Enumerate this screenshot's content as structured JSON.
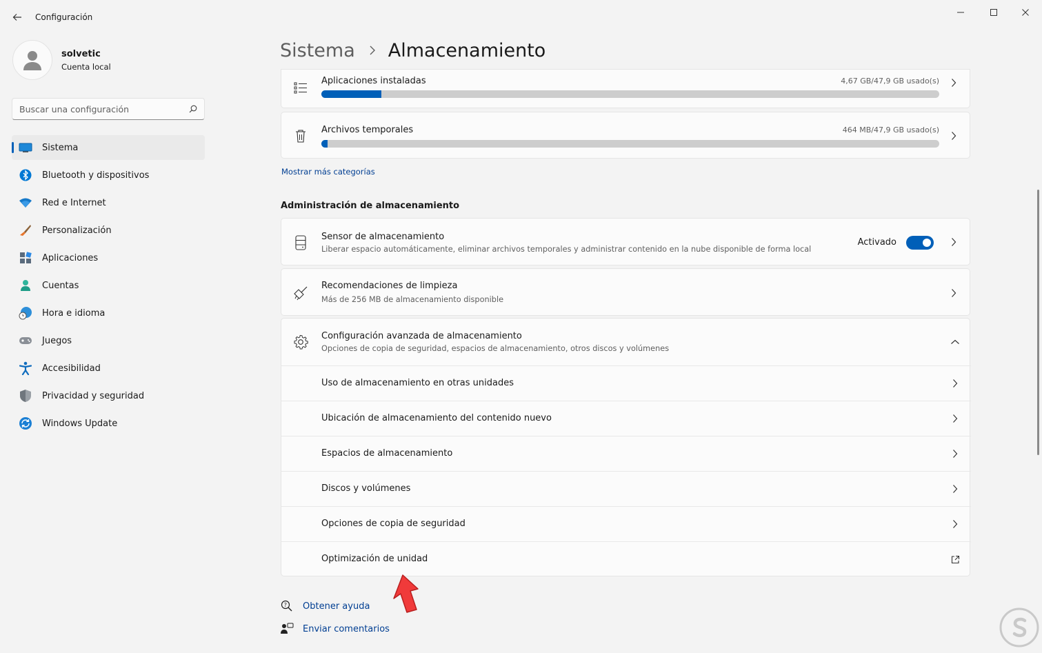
{
  "app": {
    "title": "Configuración",
    "window_controls": [
      "minimize-icon",
      "maximize-icon",
      "close-icon"
    ]
  },
  "profile": {
    "name": "solvetic",
    "subtitle": "Cuenta local"
  },
  "search": {
    "placeholder": "Buscar una configuración"
  },
  "sidebar": {
    "items": [
      {
        "label": "Sistema",
        "icon": "system-icon",
        "active": true
      },
      {
        "label": "Bluetooth y dispositivos",
        "icon": "bluetooth-icon"
      },
      {
        "label": "Red e Internet",
        "icon": "wifi-icon"
      },
      {
        "label": "Personalización",
        "icon": "brush-icon"
      },
      {
        "label": "Aplicaciones",
        "icon": "apps-icon"
      },
      {
        "label": "Cuentas",
        "icon": "account-icon"
      },
      {
        "label": "Hora e idioma",
        "icon": "globe-clock-icon"
      },
      {
        "label": "Juegos",
        "icon": "gamepad-icon"
      },
      {
        "label": "Accesibilidad",
        "icon": "accessibility-icon"
      },
      {
        "label": "Privacidad y seguridad",
        "icon": "shield-icon"
      },
      {
        "label": "Windows Update",
        "icon": "update-icon"
      }
    ]
  },
  "header": {
    "parent": "Sistema",
    "current": "Almacenamiento"
  },
  "usage": {
    "apps": {
      "label": "Aplicaciones instaladas",
      "value": "4,67 GB/47,9 GB usado(s)",
      "fraction": 0.0975
    },
    "temp": {
      "label": "Archivos temporales",
      "value": "464 MB/47,9 GB usado(s)",
      "fraction": 0.0097
    }
  },
  "more_categories": "Mostrar más categorías",
  "management": {
    "title": "Administración de almacenamiento",
    "sensor": {
      "title": "Sensor de almacenamiento",
      "subtitle": "Liberar espacio automáticamente, eliminar archivos temporales y administrar contenido en la nube disponible de forma local",
      "status": "Activado",
      "enabled": true
    },
    "cleanup": {
      "title": "Recomendaciones de limpieza",
      "subtitle": "Más de 256 MB de almacenamiento disponible"
    },
    "advanced": {
      "title": "Configuración avanzada de almacenamiento",
      "subtitle": "Opciones de copia de seguridad, espacios de almacenamiento, otros discos y volúmenes",
      "expanded": true,
      "rows": [
        "Uso de almacenamiento en otras unidades",
        "Ubicación de almacenamiento del contenido nuevo",
        "Espacios de almacenamiento",
        "Discos y volúmenes",
        "Opciones de copia de seguridad",
        "Optimización de unidad"
      ]
    }
  },
  "footer": {
    "help": "Obtener ayuda",
    "feedback": "Enviar comentarios"
  },
  "colors": {
    "accent": "#005fb8",
    "annotation_arrow": "#f03a3a"
  }
}
